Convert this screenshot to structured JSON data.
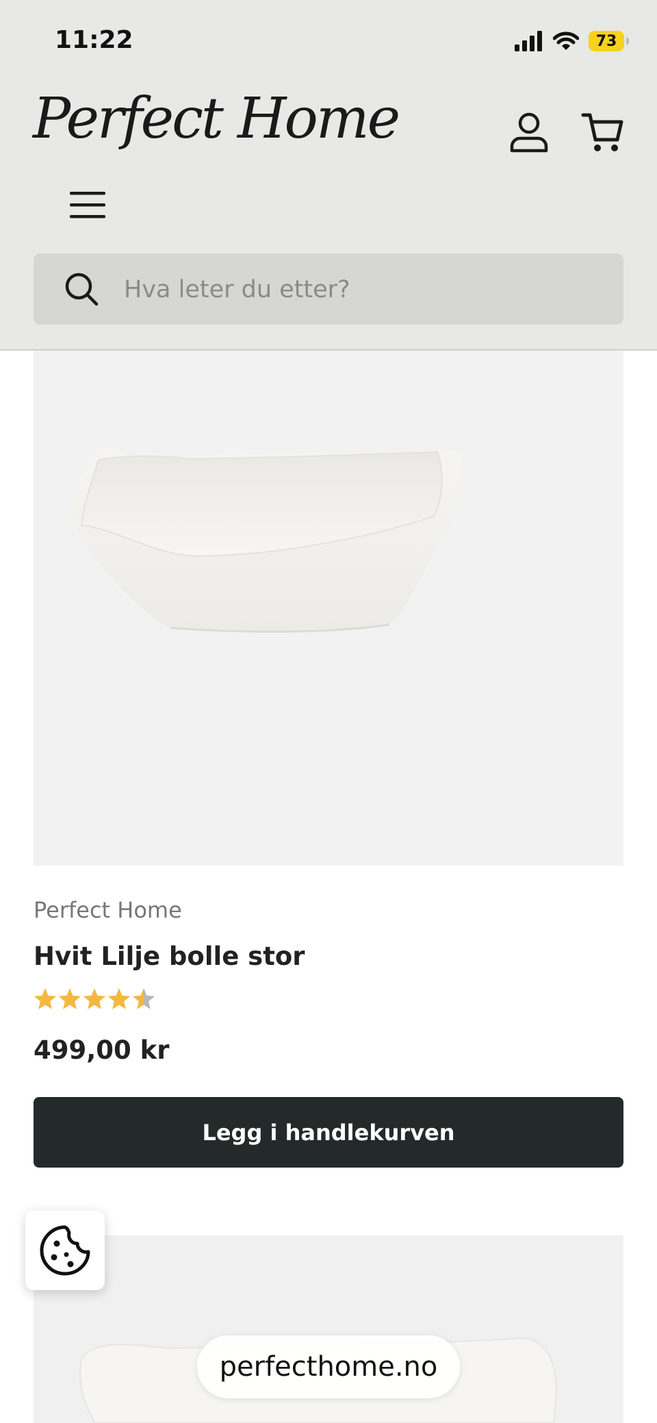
{
  "status_bar": {
    "time": "11:22",
    "battery": "73"
  },
  "header": {
    "logo": "Perfect Home",
    "search": {
      "placeholder": "Hva leter du etter?"
    }
  },
  "product": {
    "vendor": "Perfect Home",
    "title": "Hvit Lilje bolle stor",
    "rating": 4.5,
    "rating_max": 5,
    "price": "499,00 kr",
    "add_to_cart_label": "Legg i handlekurven"
  },
  "browser": {
    "url": "perfecthome.no"
  },
  "colors": {
    "header_bg": "#e8e8e6",
    "button_bg": "#242a29",
    "star": "#f4b740",
    "battery": "#f7d21b"
  }
}
